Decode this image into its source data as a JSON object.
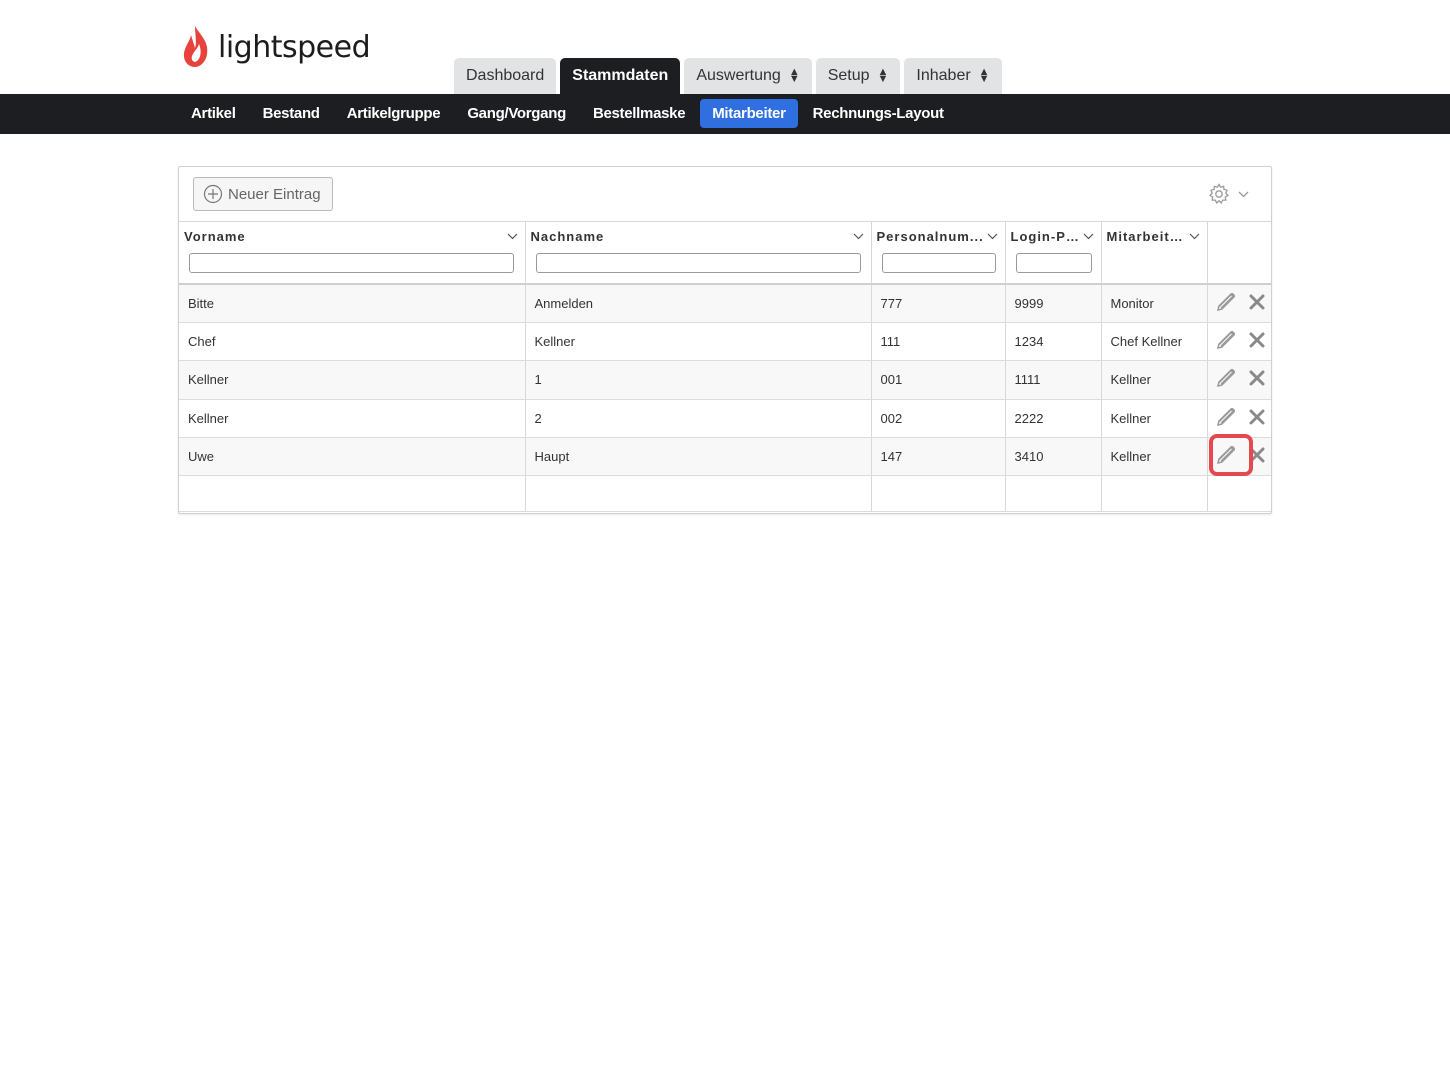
{
  "brand": {
    "name": "lightspeed",
    "accent": "#e8423d"
  },
  "top_tabs": [
    {
      "label": "Dashboard",
      "active": false,
      "dropdown": false
    },
    {
      "label": "Stammdaten",
      "active": true,
      "dropdown": false
    },
    {
      "label": "Auswertung",
      "active": false,
      "dropdown": true
    },
    {
      "label": "Setup",
      "active": false,
      "dropdown": true
    },
    {
      "label": "Inhaber",
      "active": false,
      "dropdown": true
    }
  ],
  "subnav": [
    {
      "label": "Artikel",
      "active": false
    },
    {
      "label": "Bestand",
      "active": false
    },
    {
      "label": "Artikelgruppe",
      "active": false
    },
    {
      "label": "Gang/Vorgang",
      "active": false
    },
    {
      "label": "Bestellmaske",
      "active": false
    },
    {
      "label": "Mitarbeiter",
      "active": true
    },
    {
      "label": "Rechnungs-Layout",
      "active": false
    }
  ],
  "toolbar": {
    "new_label": "Neuer Eintrag",
    "icon": "plus-circle-icon",
    "settings_icon": "gear-icon"
  },
  "table": {
    "columns": [
      "Vorname",
      "Nachname",
      "Personalnum...",
      "Login-Pl...",
      "Mitarbeite..."
    ],
    "rows": [
      [
        "Bitte",
        "Anmelden",
        "777",
        "9999",
        "Monitor"
      ],
      [
        "Chef",
        "Kellner",
        "111",
        "1234",
        "Chef Kellner"
      ],
      [
        "Kellner",
        "1",
        "001",
        "1111",
        "Kellner"
      ],
      [
        "Kellner",
        "2",
        "002",
        "2222",
        "Kellner"
      ],
      [
        "Uwe",
        "Haupt",
        "147",
        "3410",
        "Kellner"
      ]
    ],
    "highlighted_row": 4,
    "highlight_color": "#e5484d"
  }
}
